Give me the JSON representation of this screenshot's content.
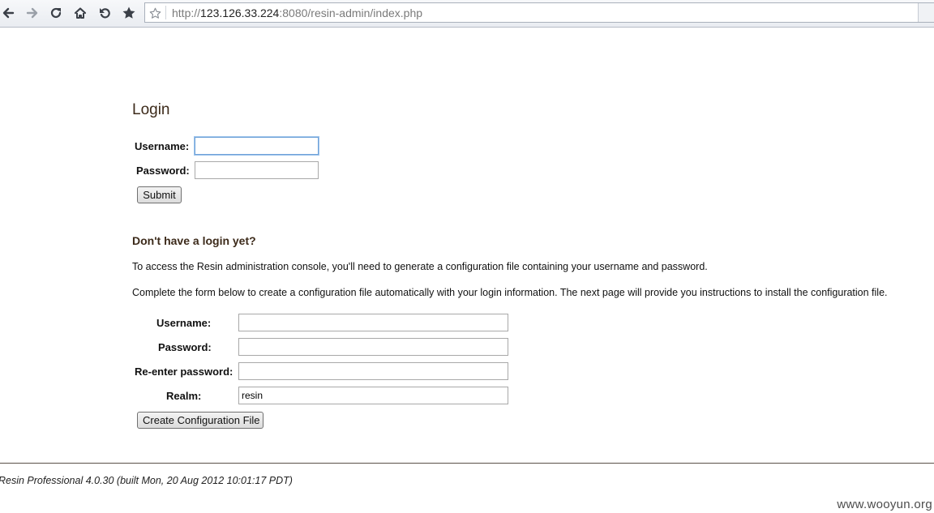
{
  "browser": {
    "url_prefix": "http://",
    "url_host": "123.126.33.224",
    "url_rest": ":8080/resin-admin/index.php",
    "icons": [
      "back-arrow-icon",
      "forward-arrow-icon",
      "reload-icon",
      "home-icon",
      "undo-icon",
      "bookmark-star-icon",
      "page-star-icon"
    ]
  },
  "login": {
    "title": "Login",
    "username_label": "Username:",
    "username_value": "",
    "password_label": "Password:",
    "password_value": "",
    "submit_label": "Submit"
  },
  "signup": {
    "heading": "Don't have a login yet?",
    "para1": "To access the Resin administration console, you'll need to generate a configuration file containing your username and password.",
    "para2": "Complete the form below to create a configuration file automatically with your login information. The next page will provide you instructions to install the configuration file.",
    "username_label": "Username:",
    "username_value": "",
    "password_label": "Password:",
    "password_value": "",
    "reenter_label": "Re-enter password:",
    "reenter_value": "",
    "realm_label": "Realm:",
    "realm_value": "resin",
    "create_label": "Create Configuration File"
  },
  "footer": {
    "version": "Resin Professional 4.0.30 (built Mon, 20 Aug 2012 10:01:17 PDT)"
  },
  "watermark": "www.wooyun.org",
  "colors": {
    "heading": "#3c2a1a",
    "focus_border": "#6fa2d8"
  }
}
